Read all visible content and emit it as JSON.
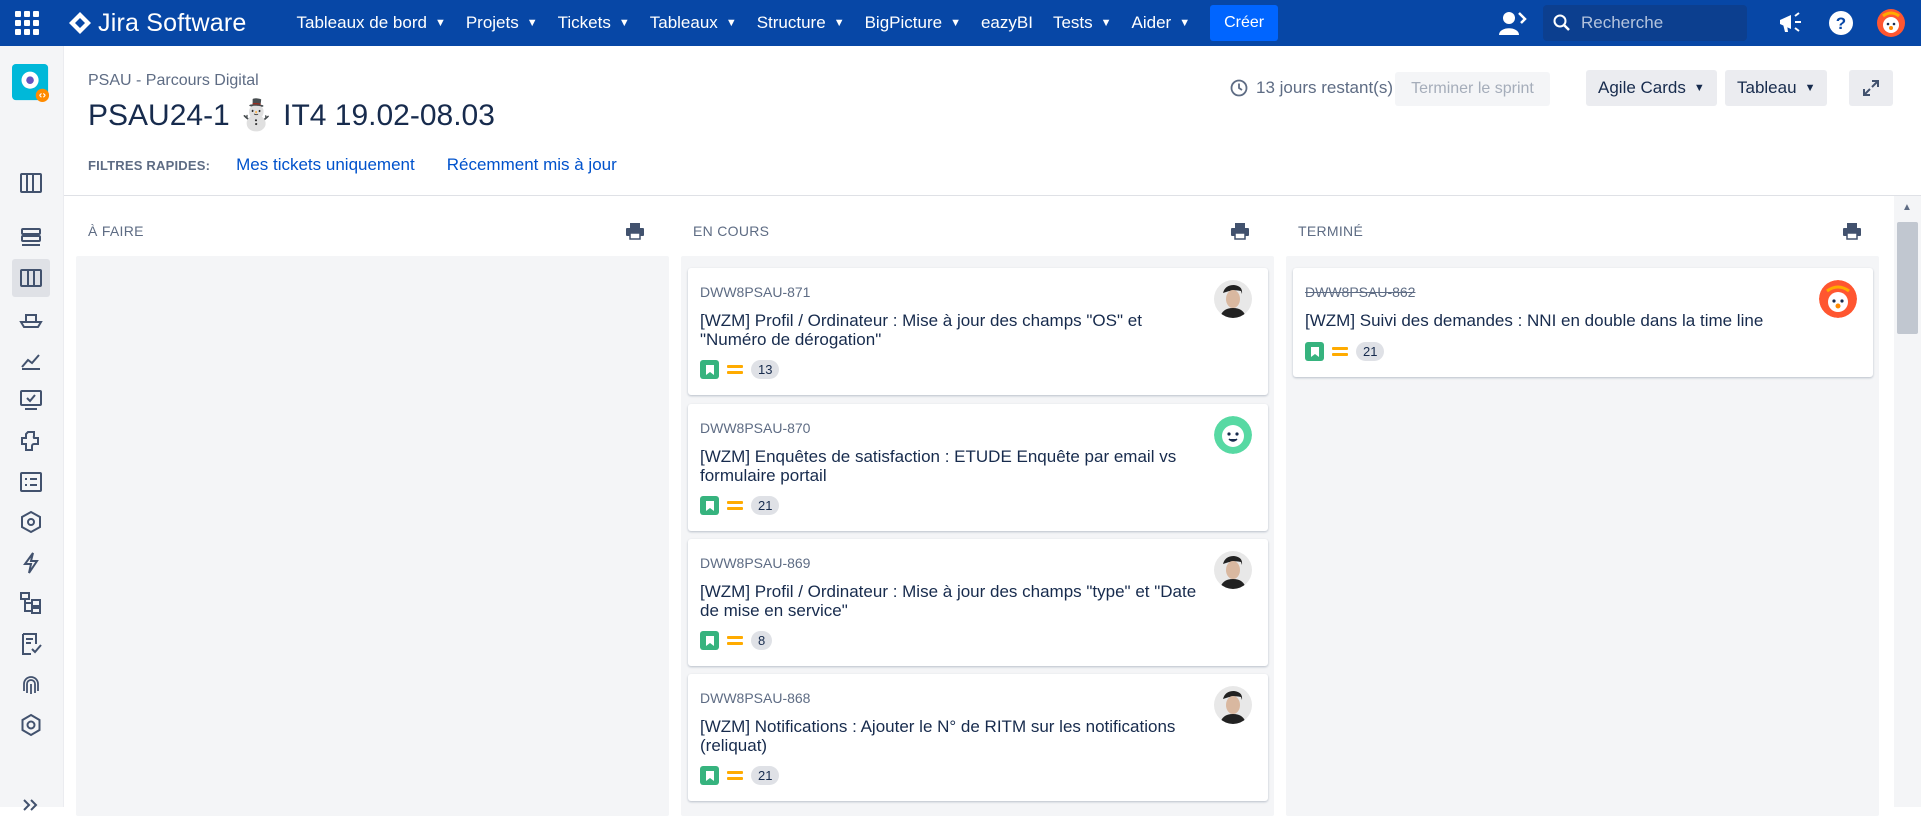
{
  "topnav": {
    "brand": "Jira Software",
    "items": [
      {
        "label": "Tableaux de bord",
        "dropdown": true
      },
      {
        "label": "Projets",
        "dropdown": true
      },
      {
        "label": "Tickets",
        "dropdown": true
      },
      {
        "label": "Tableaux",
        "dropdown": true
      },
      {
        "label": "Structure",
        "dropdown": true
      },
      {
        "label": "BigPicture",
        "dropdown": true
      },
      {
        "label": "eazyBI",
        "dropdown": false
      },
      {
        "label": "Tests",
        "dropdown": true
      },
      {
        "label": "Aider",
        "dropdown": true
      }
    ],
    "create_label": "Créer",
    "search_placeholder": "Recherche",
    "colors": {
      "bar": "#0747a6",
      "create": "#0065ff"
    }
  },
  "sidebar": {
    "icons": [
      "project-avatar-icon",
      "backlog-icon",
      "releases-icon",
      "board-icon",
      "ship-icon",
      "reports-icon",
      "tests-icon",
      "components-icon",
      "checklist-icon",
      "cube-icon",
      "lightning-icon",
      "structure-icon",
      "pages-icon",
      "fingerprint-icon",
      "settings-icon",
      "expand-sidebar-icon"
    ],
    "active": "board-icon"
  },
  "header": {
    "breadcrumb": "PSAU - Parcours Digital",
    "title_left": "PSAU24-1",
    "title_emoji": "⛄",
    "title_right": "IT4 19.02-08.03",
    "days_remaining": "13 jours restant(s)",
    "complete_sprint": "Terminer le sprint",
    "agile_cards": "Agile Cards",
    "board_view": "Tableau"
  },
  "quick_filters": {
    "label": "FILTRES RAPIDES:",
    "filters": [
      "Mes tickets uniquement",
      "Récemment mis à jour"
    ]
  },
  "columns": [
    {
      "title": "À FAIRE",
      "cards": []
    },
    {
      "title": "EN COURS",
      "cards": [
        {
          "key": "DWW8PSAU-871",
          "summary": "[WZM] Profil / Ordinateur : Mise à jour des champs \"OS\" et \"Numéro de dérogation\"",
          "points": "13",
          "avatar": "man-photo",
          "done": false
        },
        {
          "key": "DWW8PSAU-870",
          "summary": "[WZM] Enquêtes de satisfaction : ETUDE Enquête par email vs formulaire portail",
          "points": "21",
          "avatar": "teal-face",
          "done": false
        },
        {
          "key": "DWW8PSAU-869",
          "summary": "[WZM] Profil / Ordinateur : Mise à jour des champs \"type\" et \"Date de mise en service\"",
          "points": "8",
          "avatar": "man-photo",
          "done": false
        },
        {
          "key": "DWW8PSAU-868",
          "summary": "[WZM] Notifications : Ajouter le N° de RITM sur les notifications (reliquat)",
          "points": "21",
          "avatar": "man-photo",
          "done": false
        }
      ]
    },
    {
      "title": "TERMINÉ",
      "cards": [
        {
          "key": "DWW8PSAU-862",
          "summary": "[WZM] Suivi des demandes : NNI en double dans la time line",
          "points": "21",
          "avatar": "orange-face",
          "done": true
        }
      ]
    }
  ]
}
